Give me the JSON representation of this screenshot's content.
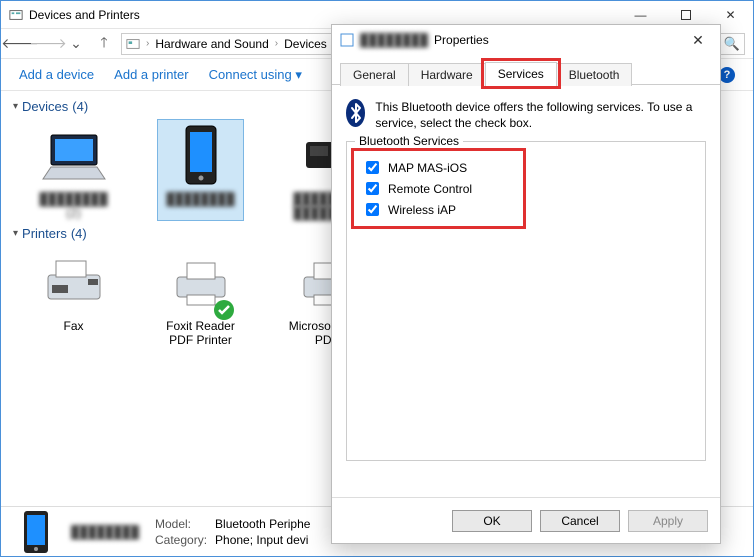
{
  "window": {
    "title": "Devices and Printers",
    "breadcrumbs": [
      "Hardware and Sound",
      "Devices"
    ]
  },
  "toolbar": {
    "add_device": "Add a device",
    "add_printer": "Add a printer",
    "connect_using": "Connect using"
  },
  "groups": {
    "devices": {
      "label": "Devices",
      "count": "(4)"
    },
    "printers": {
      "label": "Printers",
      "count": "(4)"
    }
  },
  "devices": [
    {
      "label": "████████ (2)"
    },
    {
      "label": "████████"
    },
    {
      "label": "████████"
    },
    {
      "label": "████████ ████████"
    }
  ],
  "printers": [
    {
      "label": "Fax"
    },
    {
      "label": "Foxit Reader PDF Printer"
    },
    {
      "label": "Microsoft ███ PD█"
    },
    {
      "label": ""
    }
  ],
  "details": {
    "name": "████████",
    "model_key": "Model:",
    "model_val": "Bluetooth Periphe",
    "category_key": "Category:",
    "category_val": "Phone; Input devi"
  },
  "dialog": {
    "title_prefix": "████████",
    "title_suffix": "Properties",
    "tabs": {
      "general": "General",
      "hardware": "Hardware",
      "services": "Services",
      "bluetooth": "Bluetooth"
    },
    "intro": "This Bluetooth device offers the following services. To use a service, select the check box.",
    "group_title": "Bluetooth Services",
    "services": [
      {
        "label": "MAP MAS-iOS",
        "checked": true
      },
      {
        "label": "Remote Control",
        "checked": true
      },
      {
        "label": "Wireless iAP",
        "checked": true
      }
    ],
    "buttons": {
      "ok": "OK",
      "cancel": "Cancel",
      "apply": "Apply"
    }
  }
}
